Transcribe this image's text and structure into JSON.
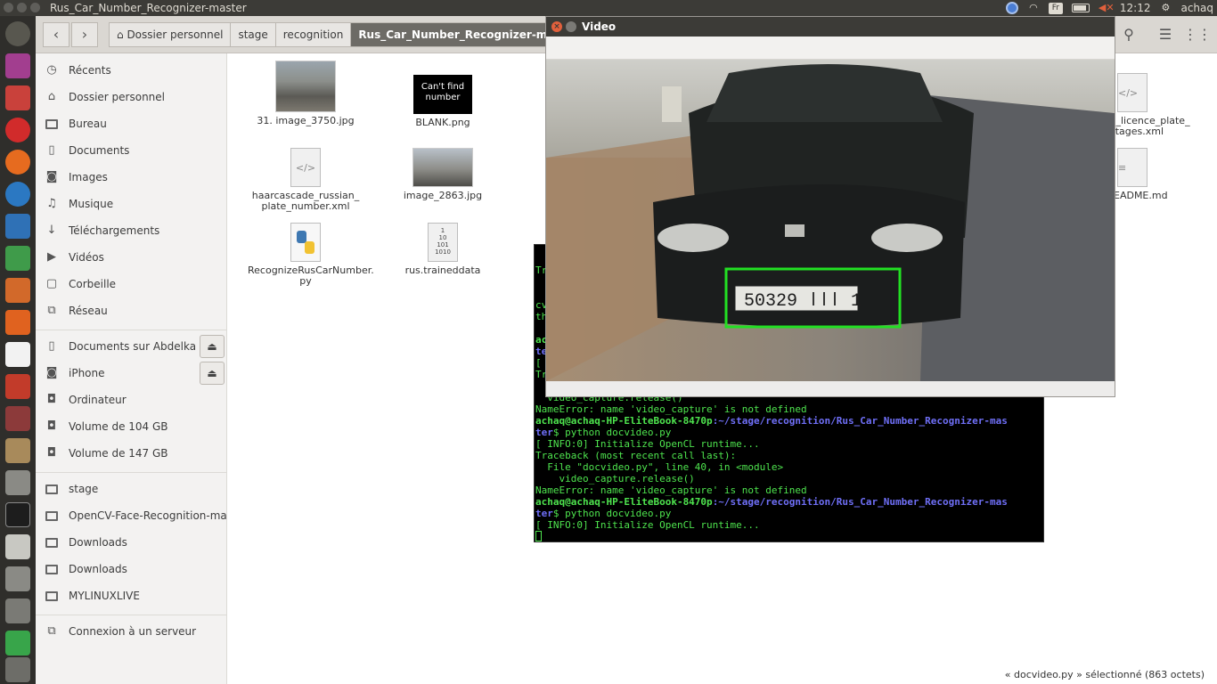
{
  "window_title": "Rus_Car_Number_Recognizer-master",
  "top_panel": {
    "keyboard": "Fr",
    "time": "12:12",
    "user": "achaq"
  },
  "breadcrumbs": [
    "Dossier personnel",
    "stage",
    "recognition",
    "Rus_Car_Number_Recognizer-master"
  ],
  "sidebar": {
    "places": [
      "Récents",
      "Dossier personnel",
      "Bureau",
      "Documents",
      "Images",
      "Musique",
      "Téléchargements",
      "Vidéos",
      "Corbeille",
      "Réseau"
    ],
    "devices": [
      "Documents sur Abdelkarim...",
      "iPhone",
      "Ordinateur",
      "Volume de 104 GB",
      "Volume de 147 GB"
    ],
    "bookmarks": [
      "stage",
      "OpenCV-Face-Recognition-master",
      "Downloads",
      "Downloads",
      "MYLINUXLIVE"
    ],
    "server": "Connexion à un serveur"
  },
  "files": [
    {
      "name": "31. image_3750.jpg",
      "icon": "image-thumbnail"
    },
    {
      "name": "BLANK.png",
      "icon": "image-thumbnail",
      "thumb_text": "Can't find number"
    },
    {
      "name": "haarcascade_russian_ plate_number.xml",
      "icon": "xml-icon"
    },
    {
      "name": "image_2863.jpg",
      "icon": "image-thumbnail"
    },
    {
      "name": "RecognizeRusCarNumber. py",
      "icon": "python-icon"
    },
    {
      "name": "rus.traineddata",
      "icon": "binary-file-icon",
      "thumb_text": "1\n10\n101\n1010"
    },
    {
      "name": "ade_licence_plate_ 16stages.xml",
      "icon": "xml-icon"
    },
    {
      "name": "EADME.md",
      "icon": "text-file-icon"
    }
  ],
  "status_bar": "« docvideo.py » sélectionné  (863 octets)",
  "video_window": {
    "title": "Video",
    "plate_text": "50329 ǀǀǀ 1"
  },
  "terminal": {
    "partial": [
      "Tr",
      "cv",
      "th",
      "ac",
      "te",
      "[",
      "Tr",
      "  video_capture.release()"
    ],
    "lines": [
      {
        "text": "NameError: name 'video_capture' is not defined",
        "style": "tg"
      },
      {
        "prompt_user": "achaq@achaq-HP-EliteBook-8470p",
        "prompt_path": ":~/stage/recognition/Rus_Car_Number_Recognizer-mas"
      },
      {
        "prompt_cont": "ter",
        "cmd": "$ python docvideo.py"
      },
      {
        "text": "[ INFO:0] Initialize OpenCL runtime...",
        "style": "tg"
      },
      {
        "text": "Traceback (most recent call last):",
        "style": "tg"
      },
      {
        "text": "  File \"docvideo.py\", line 40, in <module>",
        "style": "tg"
      },
      {
        "text": "    video_capture.release()",
        "style": "tg"
      },
      {
        "text": "NameError: name 'video_capture' is not defined",
        "style": "tg"
      },
      {
        "prompt_user": "achaq@achaq-HP-EliteBook-8470p",
        "prompt_path": ":~/stage/recognition/Rus_Car_Number_Recognizer-mas"
      },
      {
        "prompt_cont": "ter",
        "cmd": "$ python docvideo.py"
      },
      {
        "text": "[ INFO:0] Initialize OpenCL runtime...",
        "style": "tg"
      }
    ]
  }
}
